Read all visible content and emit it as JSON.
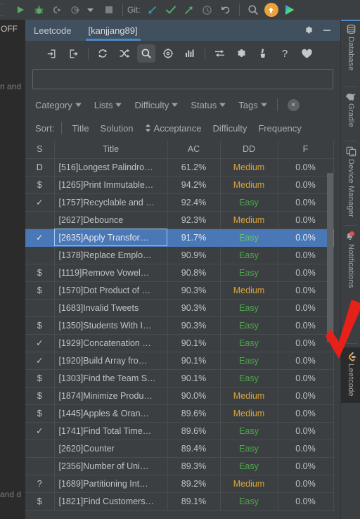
{
  "main_toolbar": {
    "git_label": "Git:",
    "icons": [
      {
        "name": "run-icon",
        "title": "Run"
      },
      {
        "name": "debug-icon",
        "title": "Debug"
      },
      {
        "name": "run-with-coverage-icon",
        "title": "Run with Coverage"
      },
      {
        "name": "profiler-icon",
        "title": "Profile"
      },
      {
        "name": "chevron-down-icon",
        "title": "More"
      },
      {
        "name": "stop-icon",
        "title": "Stop"
      },
      {
        "name": "git-update-icon",
        "title": "Update Project"
      },
      {
        "name": "git-commit-icon",
        "title": "Commit"
      },
      {
        "name": "git-push-icon",
        "title": "Push"
      },
      {
        "name": "history-icon",
        "title": "History"
      },
      {
        "name": "undo-icon",
        "title": "Undo"
      },
      {
        "name": "search-everywhere-icon",
        "title": "Search Everywhere"
      },
      {
        "name": "update-available-icon",
        "title": "Update"
      },
      {
        "name": "ide-logo-icon",
        "title": "IDE"
      }
    ]
  },
  "editor": {
    "tab_label": "OFF",
    "fragment_top": "n  and",
    "fragment_bottom": "and  d"
  },
  "tool_window": {
    "tabs": [
      {
        "label": "Leetcode",
        "active": false
      },
      {
        "label": "[kanjjang89]",
        "active": true
      }
    ],
    "actions": [
      {
        "name": "settings-gear-icon",
        "label": "Settings"
      },
      {
        "name": "minimize-icon",
        "label": "Hide"
      }
    ],
    "toolbar_icons": [
      {
        "name": "sign-in-icon",
        "label": "Sign In",
        "active": false
      },
      {
        "name": "sign-out-icon",
        "label": "Sign Out",
        "active": false
      },
      {
        "name": "refresh-icon",
        "label": "Refresh",
        "active": false
      },
      {
        "name": "shuffle-icon",
        "label": "Random Question",
        "active": false
      },
      {
        "name": "search-icon",
        "label": "Search",
        "active": true
      },
      {
        "name": "target-icon",
        "label": "Daily Question",
        "active": false
      },
      {
        "name": "statistics-icon",
        "label": "Statistics",
        "active": false
      },
      {
        "name": "submit-icon",
        "label": "Submit",
        "active": false
      },
      {
        "name": "settings-icon",
        "label": "Settings",
        "active": false
      },
      {
        "name": "clear-cache-icon",
        "label": "Clear Cache",
        "active": false
      },
      {
        "name": "help-icon",
        "label": "Help",
        "active": false
      },
      {
        "name": "favorite-icon",
        "label": "Favorite",
        "active": false
      }
    ],
    "search": {
      "value": "",
      "placeholder": ""
    },
    "filters": [
      {
        "label": "Category"
      },
      {
        "label": "Lists"
      },
      {
        "label": "Difficulty"
      },
      {
        "label": "Status"
      },
      {
        "label": "Tags"
      }
    ],
    "clear_filters_label": "×",
    "sort": {
      "label": "Sort:",
      "options": [
        "Title",
        "Solution",
        "Acceptance",
        "Difficulty",
        "Frequency"
      ],
      "active": "Acceptance"
    },
    "table": {
      "columns": [
        "S",
        "Title",
        "AC",
        "DD",
        "F"
      ],
      "rows": [
        {
          "s": "D",
          "title": "[516]Longest Palindro…",
          "ac": "61.2%",
          "dd": "Medium",
          "f": "0.0%",
          "selected": false
        },
        {
          "s": "$",
          "title": "[1265]Print Immutable…",
          "ac": "94.2%",
          "dd": "Medium",
          "f": "0.0%",
          "selected": false
        },
        {
          "s": "✓",
          "title": "[1757]Recyclable and …",
          "ac": "92.4%",
          "dd": "Easy",
          "f": "0.0%",
          "selected": false
        },
        {
          "s": "",
          "title": "[2627]Debounce",
          "ac": "92.3%",
          "dd": "Medium",
          "f": "0.0%",
          "selected": false
        },
        {
          "s": "✓",
          "title": "[2635]Apply Transfor…",
          "ac": "91.7%",
          "dd": "Easy",
          "f": "0.0%",
          "selected": true
        },
        {
          "s": "",
          "title": "[1378]Replace Emplo…",
          "ac": "90.9%",
          "dd": "Easy",
          "f": "0.0%",
          "selected": false
        },
        {
          "s": "$",
          "title": "[1119]Remove Vowel…",
          "ac": "90.8%",
          "dd": "Easy",
          "f": "0.0%",
          "selected": false
        },
        {
          "s": "$",
          "title": "[1570]Dot Product of …",
          "ac": "90.3%",
          "dd": "Medium",
          "f": "0.0%",
          "selected": false
        },
        {
          "s": "",
          "title": "[1683]Invalid Tweets",
          "ac": "90.3%",
          "dd": "Easy",
          "f": "0.0%",
          "selected": false
        },
        {
          "s": "$",
          "title": "[1350]Students With I…",
          "ac": "90.3%",
          "dd": "Easy",
          "f": "0.0%",
          "selected": false
        },
        {
          "s": "✓",
          "title": "[1929]Concatenation …",
          "ac": "90.1%",
          "dd": "Easy",
          "f": "0.0%",
          "selected": false
        },
        {
          "s": "✓",
          "title": "[1920]Build Array fro…",
          "ac": "90.1%",
          "dd": "Easy",
          "f": "0.0%",
          "selected": false
        },
        {
          "s": "$",
          "title": "[1303]Find the Team S…",
          "ac": "90.1%",
          "dd": "Easy",
          "f": "0.0%",
          "selected": false
        },
        {
          "s": "$",
          "title": "[1874]Minimize Produ…",
          "ac": "90.0%",
          "dd": "Medium",
          "f": "0.0%",
          "selected": false
        },
        {
          "s": "$",
          "title": "[1445]Apples & Oran…",
          "ac": "89.6%",
          "dd": "Medium",
          "f": "0.0%",
          "selected": false
        },
        {
          "s": "✓",
          "title": "[1741]Find Total Time…",
          "ac": "89.6%",
          "dd": "Easy",
          "f": "0.0%",
          "selected": false
        },
        {
          "s": "",
          "title": "[2620]Counter",
          "ac": "89.4%",
          "dd": "Easy",
          "f": "0.0%",
          "selected": false
        },
        {
          "s": "",
          "title": "[2356]Number of Uni…",
          "ac": "89.3%",
          "dd": "Easy",
          "f": "0.0%",
          "selected": false
        },
        {
          "s": "?",
          "title": "[1689]Partitioning Int…",
          "ac": "89.2%",
          "dd": "Medium",
          "f": "0.0%",
          "selected": false
        },
        {
          "s": "$",
          "title": "[1821]Find Customers…",
          "ac": "89.1%",
          "dd": "Easy",
          "f": "0.0%",
          "selected": false
        }
      ]
    }
  },
  "right_bar": [
    {
      "label": "Database",
      "icon": "database-icon",
      "selected": false
    },
    {
      "label": "Gradle",
      "icon": "gradle-elephant-icon",
      "selected": false
    },
    {
      "label": "Device Manager",
      "icon": "device-manager-icon",
      "selected": false
    },
    {
      "label": "Notifications",
      "icon": "bell-icon",
      "selected": false
    },
    {
      "label": "Leetcode",
      "icon": "leetcode-icon",
      "selected": true
    }
  ],
  "colors": {
    "accent_blue": "#4a88c7",
    "selection_blue": "#4a77b5",
    "easy_green": "#4ca64c",
    "medium_orange": "#d9a43b",
    "annotation_red": "#e8201a",
    "panel_bg": "#3c3f41",
    "editor_bg": "#2b2b2b",
    "tabbar_bg": "#41505f"
  },
  "annotation": {
    "name": "red-check-arrow"
  }
}
